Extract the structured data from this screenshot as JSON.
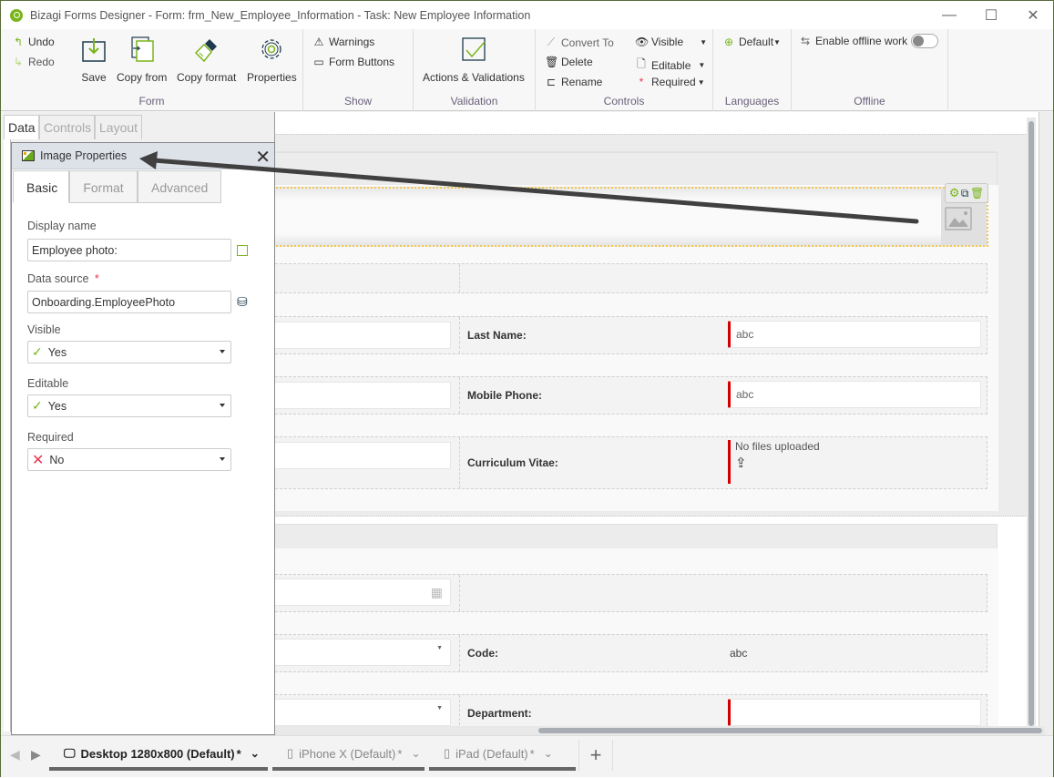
{
  "window": {
    "title": "Bizagi Forms Designer  - Form: frm_New_Employee_Information - Task:  New Employee Information",
    "minimize": "—",
    "maximize": "☐",
    "close": "✕"
  },
  "ribbon": {
    "undo": "Undo",
    "redo": "Redo",
    "save": "Save",
    "copy_from": "Copy from",
    "copy_format": "Copy format",
    "properties": "Properties",
    "group_form": "Form",
    "warnings": "Warnings",
    "form_buttons": "Form Buttons",
    "group_show": "Show",
    "actions_validations": "Actions & Validations",
    "group_validation": "Validation",
    "convert_to": "Convert To",
    "delete": "Delete",
    "rename": "Rename",
    "visible": "Visible",
    "editable": "Editable",
    "required": "Required",
    "group_controls": "Controls",
    "language_default": "Default",
    "group_languages": "Languages",
    "enable_offline": "Enable offline work",
    "group_offline": "Offline",
    "offline_enabled": false
  },
  "left_panel": {
    "tabs": [
      "Data",
      "Controls",
      "Layout"
    ],
    "active_tab": "Data"
  },
  "properties_window": {
    "title": "Image Properties",
    "tabs": [
      "Basic",
      "Format",
      "Advanced"
    ],
    "active_tab": "Basic",
    "display_name_label": "Display name",
    "display_name_value": "Employee photo:",
    "data_source_label": "Data source",
    "data_source_required_mark": "*",
    "data_source_value": "Onboarding.EmployeePhoto",
    "visible_label": "Visible",
    "visible_value": "Yes",
    "editable_label": "Editable",
    "editable_value": "Yes",
    "required_label": "Required",
    "required_value": "No"
  },
  "form": {
    "fields": [
      {
        "label": "Last Name:",
        "value": "abc",
        "required": true
      },
      {
        "label": "Mobile Phone:",
        "value": "abc",
        "required": true
      },
      {
        "label": "Curriculum Vitae:",
        "value": "No files uploaded",
        "required": true
      },
      {
        "label": "Code:",
        "value": "abc",
        "required": false
      },
      {
        "label": "Department:",
        "value": "",
        "required": true
      }
    ]
  },
  "device_tabs": [
    {
      "label": "Desktop 1280x800 (Default)",
      "modified_mark": "*",
      "active": true
    },
    {
      "label": "iPhone X (Default)",
      "modified_mark": "*",
      "active": false
    },
    {
      "label": "iPad (Default)",
      "modified_mark": "*",
      "active": false
    }
  ],
  "add_tab": "+",
  "colors": {
    "accent_green": "#7ab51d",
    "required_red": "#d40000",
    "selection_yellow": "#f0c850"
  }
}
